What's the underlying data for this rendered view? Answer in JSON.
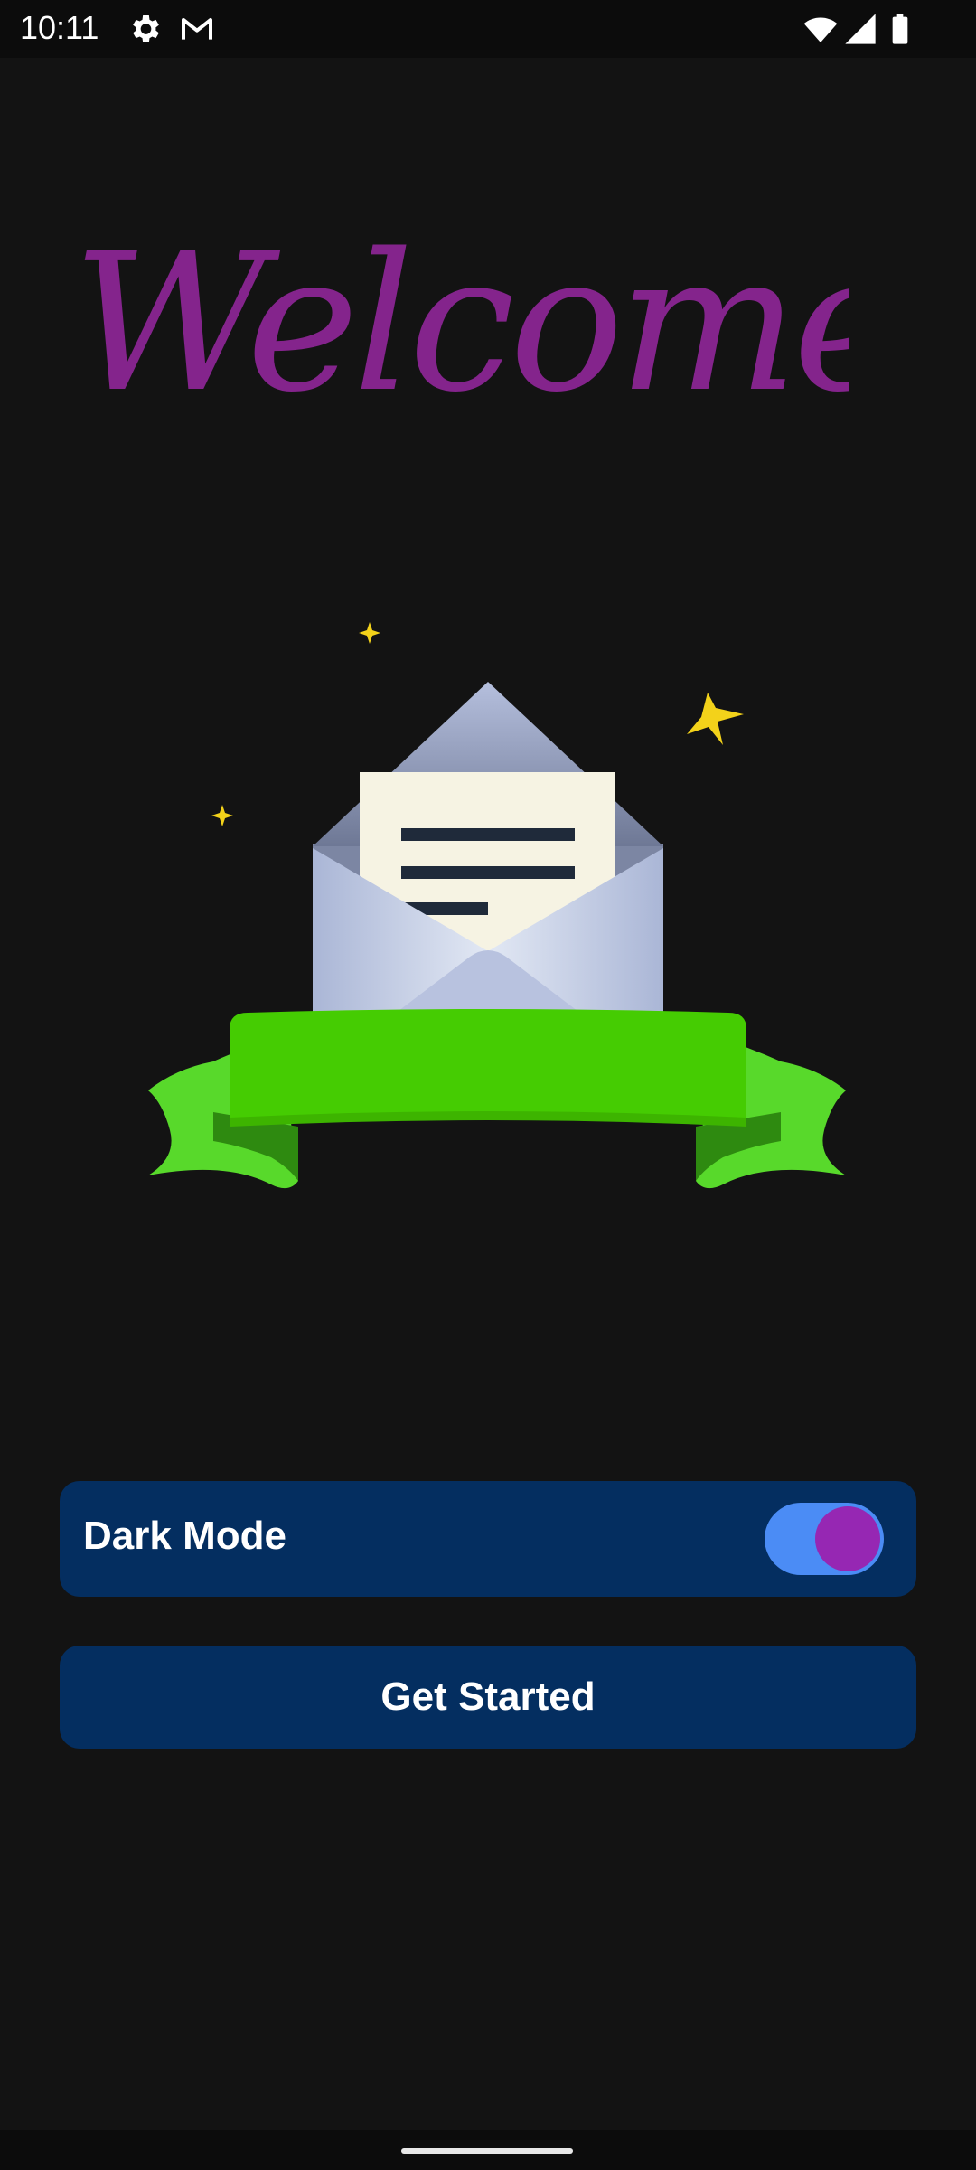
{
  "status_bar": {
    "time": "10:11",
    "icons": [
      "settings-icon",
      "gmail-icon",
      "wifi-icon",
      "signal-icon",
      "battery-icon"
    ]
  },
  "welcome": {
    "title": "Welcome",
    "color": "#84248c"
  },
  "illustration": {
    "name": "open-envelope-with-ribbon"
  },
  "dark_mode": {
    "label": "Dark Mode",
    "enabled": true,
    "track_color": "#4b8cf5",
    "knob_color": "#9627b3"
  },
  "get_started": {
    "label": "Get Started"
  },
  "theme": {
    "background": "#131313",
    "card": "#042e60"
  }
}
